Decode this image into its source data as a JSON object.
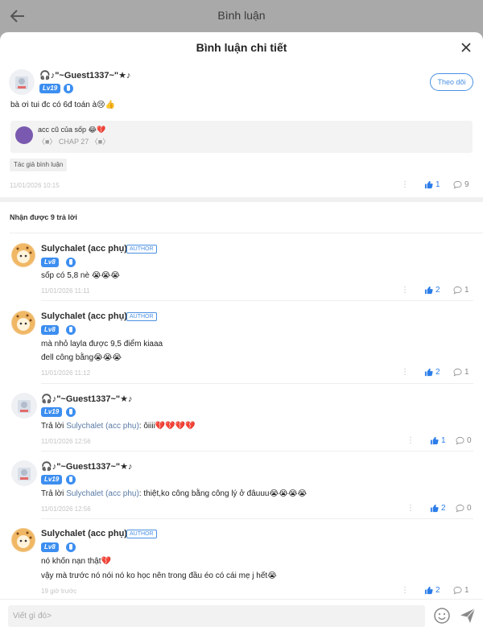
{
  "topbar": {
    "title": "Bình luận",
    "back_icon": "arrow-left-icon"
  },
  "sheet": {
    "title": "Bình luận chi tiết",
    "close_icon": "close-icon"
  },
  "main_comment": {
    "username": "🎧♪\"~Guest1337~\"★♪",
    "level": "Lv19",
    "follow_label": "Theo dõi",
    "text": "bà ơi tui đc có 6đ toán à😢👍",
    "quote": {
      "text": "acc cũ của sốp 😂💔",
      "sub": "〈■〉 CHAP 27 〈■〉"
    },
    "author_tag": "Tác giả bình luận",
    "time": "11/01/2026 10:15",
    "likes": "1",
    "comments": "9"
  },
  "replies_header": "Nhận được 9 trả lời",
  "replies": [
    {
      "username": "Sulychalet (acc phụ)",
      "level": "Lv8",
      "author_badge": "AUTHOR",
      "lines": [
        "sốp có 5,8 nè 😭😭😭"
      ],
      "time": "11/01/2026 11:11",
      "likes": "2",
      "comments": "1"
    },
    {
      "username": "Sulychalet (acc phụ)",
      "level": "Lv8",
      "author_badge": "AUTHOR",
      "lines": [
        "mà nhỏ layla được 9,5 điểm kiaaa",
        "đell công bằng😭😭😭"
      ],
      "time": "11/01/2026 11:12",
      "likes": "2",
      "comments": "1"
    },
    {
      "username": "🎧♪\"~Guest1337~\"★♪",
      "level": "Lv19",
      "prefix": "Trả lời ",
      "mention": "Sulychalet (acc phụ)",
      "suffix": ": ôiiii💔💔💔💔",
      "time": "11/01/2026 12:56",
      "likes": "1",
      "comments": "0"
    },
    {
      "username": "🎧♪\"~Guest1337~\"★♪",
      "level": "Lv19",
      "prefix": "Trả lời ",
      "mention": "Sulychalet (acc phụ)",
      "suffix": ": thiệt,ko công bằng công lý ở đâuuu😭😭😭😭",
      "time": "11/01/2026 12:56",
      "likes": "2",
      "comments": "0"
    },
    {
      "username": "Sulychalet (acc phụ)",
      "level": "Lv8",
      "author_badge": "AUTHOR",
      "lines": [
        "nó khốn nạn thật💔",
        "vậy mà trước nó nói nó ko học nên trong đầu éo có cái mẹ j hết😭"
      ],
      "time": "19 giờ trước",
      "likes": "2",
      "comments": "1"
    }
  ],
  "bottom": {
    "placeholder": "Viết gì đó>",
    "smile_icon": "smile-icon",
    "send_icon": "send-icon"
  },
  "colors": {
    "accent": "#4a90e2",
    "like": "#2b7de9",
    "topbar": "#a9a9a9"
  }
}
